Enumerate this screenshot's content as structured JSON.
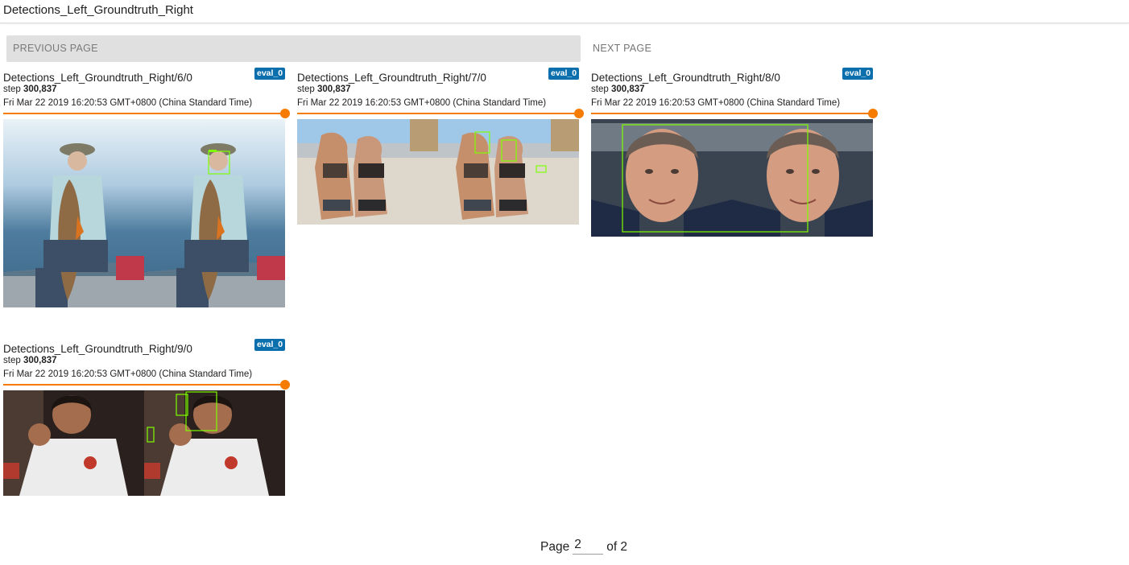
{
  "section": {
    "title": "Detections_Left_Groundtruth_Right"
  },
  "nav": {
    "previous_label": "PREVIOUS PAGE",
    "next_label": "NEXT PAGE"
  },
  "cards": [
    {
      "title": "Detections_Left_Groundtruth_Right/6/0",
      "run": "eval_0",
      "step_prefix": "step",
      "step": "300,837",
      "timestamp": "Fri Mar 22 2019 16:20:53 GMT+0800 (China Standard Time)"
    },
    {
      "title": "Detections_Left_Groundtruth_Right/7/0",
      "run": "eval_0",
      "step_prefix": "step",
      "step": "300,837",
      "timestamp": "Fri Mar 22 2019 16:20:53 GMT+0800 (China Standard Time)"
    },
    {
      "title": "Detections_Left_Groundtruth_Right/8/0",
      "run": "eval_0",
      "step_prefix": "step",
      "step": "300,837",
      "timestamp": "Fri Mar 22 2019 16:20:53 GMT+0800 (China Standard Time)"
    },
    {
      "title": "Detections_Left_Groundtruth_Right/9/0",
      "run": "eval_0",
      "step_prefix": "step",
      "step": "300,837",
      "timestamp": "Fri Mar 22 2019 16:20:53 GMT+0800 (China Standard Time)"
    }
  ],
  "pagination": {
    "page_label": "Page",
    "current_page": "2",
    "of_label": "of 2"
  },
  "colors": {
    "accent": "#f57c00",
    "badge": "#0b6fad",
    "box": "#7fff00"
  }
}
